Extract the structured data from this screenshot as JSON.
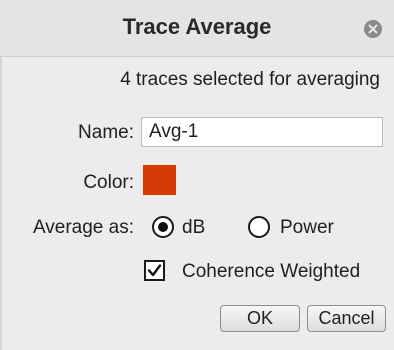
{
  "dialog": {
    "title": "Trace Average",
    "info_text": "4 traces selected for averaging"
  },
  "name_field": {
    "label": "Name:",
    "value": "Avg-1"
  },
  "color_field": {
    "label": "Color:",
    "swatch_color": "#d63b06"
  },
  "average_as": {
    "label": "Average as:",
    "options": [
      "dB",
      "Power"
    ],
    "selected": "dB"
  },
  "coherence": {
    "label": "Coherence Weighted",
    "checked": true
  },
  "buttons": {
    "ok": "OK",
    "cancel": "Cancel"
  },
  "icons": {
    "close": "close-icon",
    "check": "checkmark-icon"
  }
}
